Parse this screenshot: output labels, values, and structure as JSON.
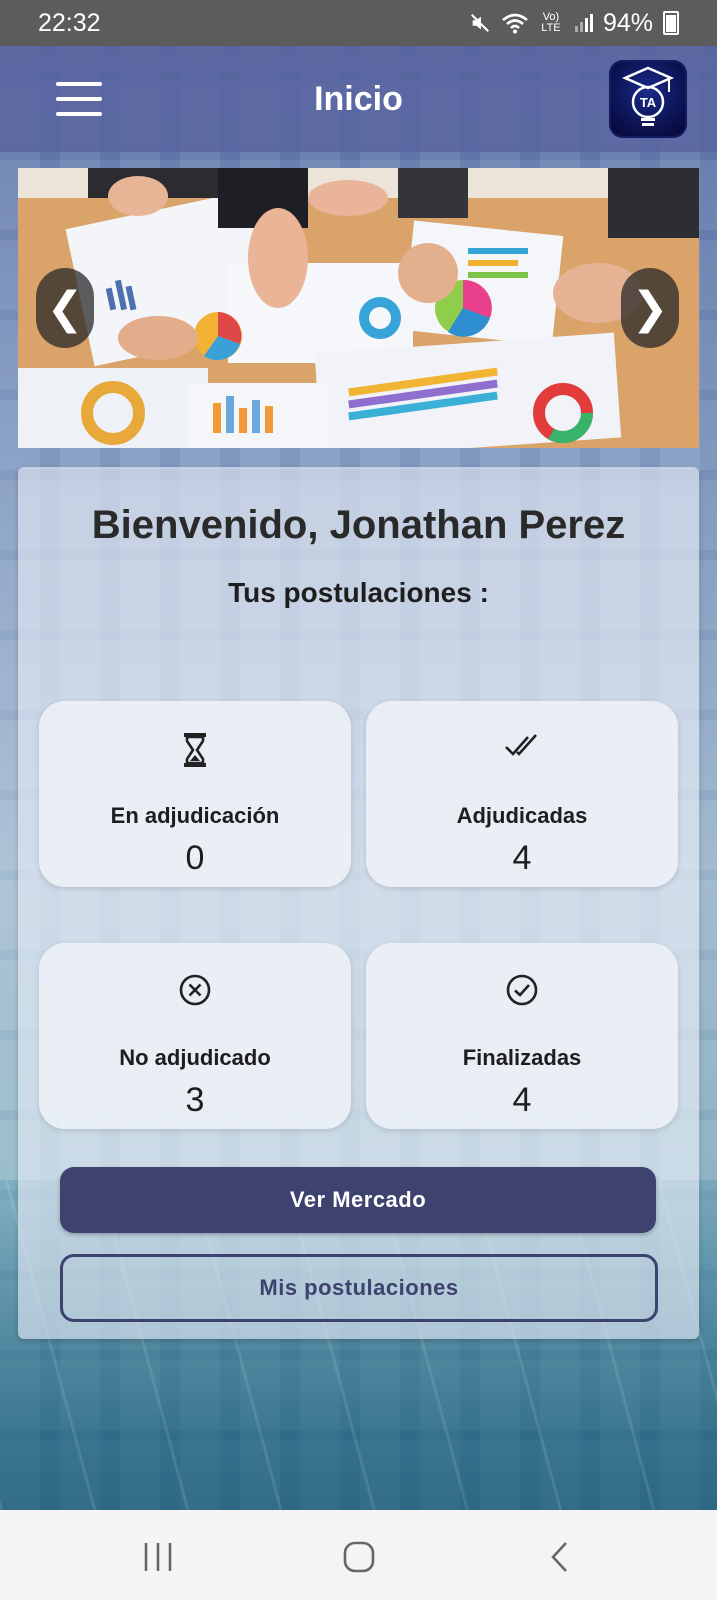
{
  "status_bar": {
    "time": "22:32",
    "network_label": "Vo) LTE",
    "battery": "94%",
    "icons": [
      "mute-icon",
      "wifi-icon",
      "signal-icon",
      "battery-icon"
    ]
  },
  "app_bar": {
    "title": "Inicio",
    "logo_text": "TA",
    "icons": [
      "menu-icon",
      "app-logo-icon"
    ]
  },
  "carousel": {
    "prev_label": "❮",
    "next_label": "❯"
  },
  "welcome": {
    "greeting": "Bienvenido, Jonathan Perez",
    "subtitle": "Tus postulaciones :"
  },
  "stats": [
    {
      "label": "En adjudicación",
      "value": "0",
      "icon": "hourglass-icon"
    },
    {
      "label": "Adjudicadas",
      "value": "4",
      "icon": "double-check-icon"
    },
    {
      "label": "No adjudicado",
      "value": "3",
      "icon": "cancel-circle-icon"
    },
    {
      "label": "Finalizadas",
      "value": "4",
      "icon": "check-circle-icon"
    }
  ],
  "actions": {
    "primary_label": "Ver Mercado",
    "secondary_label": "Mis postulaciones"
  },
  "nav_bar": {
    "icons": [
      "recent-apps-icon",
      "home-icon",
      "back-icon"
    ]
  },
  "colors": {
    "primary": "#3d426e",
    "app_bar": "#5864a0",
    "status_bar": "#5c5c5c"
  }
}
